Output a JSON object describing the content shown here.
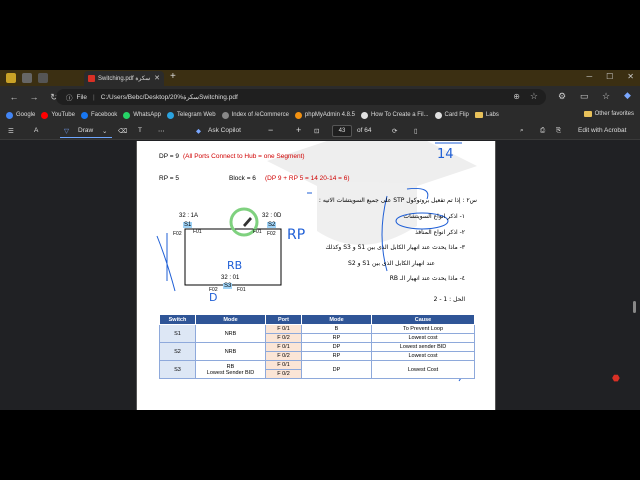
{
  "browser": {
    "tab_title": "Switching.pdf سكرة",
    "new_tab": "+",
    "nav": {
      "back": "←",
      "forward": "→",
      "refresh": "↻"
    },
    "address": {
      "scheme": "File",
      "url": "C:/Users/Bebc/Desktop/20%سكرةSwitching.pdf"
    },
    "bookmarks": [
      {
        "label": "Google",
        "color": "#4285f4"
      },
      {
        "label": "YouTube",
        "color": "#ff0000"
      },
      {
        "label": "Facebook",
        "color": "#1877f2"
      },
      {
        "label": "WhatsApp",
        "color": "#25d366"
      },
      {
        "label": "Telegram Web",
        "color": "#2aa3e0"
      },
      {
        "label": "Index of /eCommerce",
        "color": "#888888"
      },
      {
        "label": "phpMyAdmin 4.8.5",
        "color": "#f29111"
      },
      {
        "label": "How To Create a Fil...",
        "color": "#e0e0e0"
      },
      {
        "label": "Card Flip",
        "color": "#e0e0e0"
      },
      {
        "label": "Labs",
        "color": "#e8c15a"
      }
    ],
    "other_favorites": "Other favorites"
  },
  "pdf_toolbar": {
    "draw": "Draw",
    "ask_copilot": "Ask Copilot",
    "zoom_minus": "−",
    "zoom_plus": "+",
    "page_current": "43",
    "page_total": "of 64",
    "edit_acrobat": "Edit with Acrobat"
  },
  "document": {
    "dp_line_a": "DP = 9",
    "dp_line_b": "(All Ports Connect to Hub = one Segment)",
    "rp_line": "RP = 5",
    "block_a": "Block = 6",
    "block_b": "(DP 9 + RP 5 = 14      20-14 = 6)",
    "question_title": "س٢ : إذا تم تفعيل بروتوكول STP على جميع السويتشات الاتيه :",
    "q1": "١- اذكر انواع السويتشات",
    "q2": "٢- اذكر انواع المنافذ",
    "q3": "٣- ماذا يحدث عند انهيار الكابل الذى بين S1 و S3 وكذلك",
    "q3b": "عند انهيار الكابل الذى بين S1 و S2",
    "q4": "٤- ماذا يحدث عند انهيار الـ RB",
    "solution": "الحل : 1 - 2",
    "s1_label": "32 : 1A",
    "s2_label": "32 : 0D",
    "s3_label": "32 : 01",
    "s1": "S1",
    "s2": "S2",
    "s3": "S3",
    "f01": "F01",
    "f02": "F02",
    "handwritten": {
      "h14": "14",
      "rp": "RP",
      "rb": "RB",
      "d": "D"
    },
    "table": {
      "headers": [
        "Switch",
        "Mode",
        "Port",
        "Mode",
        "Cause"
      ],
      "rows": [
        {
          "switch": "S1",
          "mode": "NRB",
          "port": "F 0/1",
          "pmode": "B",
          "cause": "To Prevent Loop"
        },
        {
          "switch": "",
          "mode": "",
          "port": "F 0/2",
          "pmode": "RP",
          "cause": "Lowest cost"
        },
        {
          "switch": "S2",
          "mode": "NRB",
          "port": "F 0/1",
          "pmode": "DP",
          "cause": "Lowest sender BID"
        },
        {
          "switch": "",
          "mode": "",
          "port": "F 0/2",
          "pmode": "RP",
          "cause": "Lowest cost"
        },
        {
          "switch": "S3",
          "mode": "RB",
          "mode2": "Lowest Sender BID",
          "port": "F 0/1",
          "pmode": "DP",
          "cause": "Lowest Cost"
        },
        {
          "switch": "",
          "mode": "",
          "port": "F 0/2",
          "pmode": "",
          "cause": ""
        }
      ]
    }
  }
}
